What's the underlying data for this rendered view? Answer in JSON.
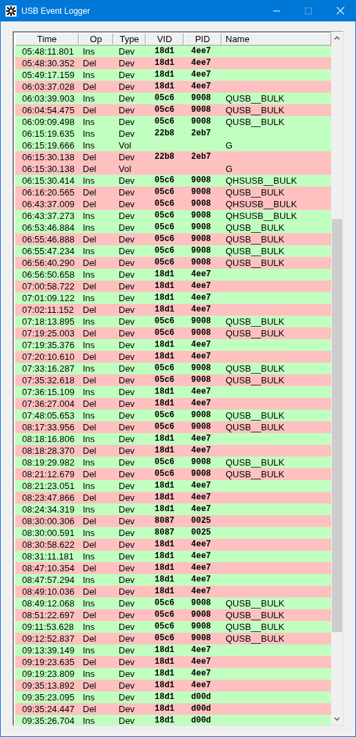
{
  "window": {
    "title": "USB Event Logger"
  },
  "table": {
    "columns": [
      "Time",
      "Op",
      "Type",
      "VID",
      "PID",
      "Name"
    ],
    "rows": [
      {
        "kind": "ins",
        "time": "05:48:11.801",
        "op": "Ins",
        "type": "Dev",
        "vid": "18d1",
        "pid": "4ee7"
      },
      {
        "kind": "del",
        "time": "05:48:30.352",
        "op": "Del",
        "type": "Dev",
        "vid": "18d1",
        "pid": "4ee7"
      },
      {
        "kind": "ins",
        "time": "05:49:17.159",
        "op": "Ins",
        "type": "Dev",
        "vid": "18d1",
        "pid": "4ee7"
      },
      {
        "kind": "del",
        "time": "06:03:37.028",
        "op": "Del",
        "type": "Dev",
        "vid": "18d1",
        "pid": "4ee7"
      },
      {
        "kind": "ins",
        "time": "06:03:39.903",
        "op": "Ins",
        "type": "Dev",
        "vid": "05c6",
        "pid": "9008",
        "name": "QUSB__BULK"
      },
      {
        "kind": "del",
        "time": "06:04:54.475",
        "op": "Del",
        "type": "Dev",
        "vid": "05c6",
        "pid": "9008",
        "name": "QUSB__BULK"
      },
      {
        "kind": "ins",
        "time": "06:09:09.498",
        "op": "Ins",
        "type": "Dev",
        "vid": "05c6",
        "pid": "9008",
        "name": "QUSB__BULK"
      },
      {
        "kind": "ins",
        "time": "06:15:19.635",
        "op": "Ins",
        "type": "Dev",
        "vid": "22b8",
        "pid": "2eb7"
      },
      {
        "kind": "ins",
        "time": "06:15:19.666",
        "op": "Ins",
        "type": "Vol",
        "name": "G"
      },
      {
        "kind": "del",
        "time": "06:15:30.138",
        "op": "Del",
        "type": "Dev",
        "vid": "22b8",
        "pid": "2eb7"
      },
      {
        "kind": "del",
        "time": "06:15:30.138",
        "op": "Del",
        "type": "Vol",
        "name": "G"
      },
      {
        "kind": "ins",
        "time": "06:15:30.414",
        "op": "Ins",
        "type": "Dev",
        "vid": "05c6",
        "pid": "9008",
        "name": "QHSUSB__BULK"
      },
      {
        "kind": "del",
        "time": "06:16:20.565",
        "op": "Del",
        "type": "Dev",
        "vid": "05c6",
        "pid": "9008",
        "name": "QUSB__BULK"
      },
      {
        "kind": "del",
        "time": "06:43:37.009",
        "op": "Del",
        "type": "Dev",
        "vid": "05c6",
        "pid": "9008",
        "name": "QHSUSB__BULK"
      },
      {
        "kind": "ins",
        "time": "06:43:37.273",
        "op": "Ins",
        "type": "Dev",
        "vid": "05c6",
        "pid": "9008",
        "name": "QHSUSB__BULK"
      },
      {
        "kind": "ins",
        "time": "06:53:46.884",
        "op": "Ins",
        "type": "Dev",
        "vid": "05c6",
        "pid": "9008",
        "name": "QUSB__BULK"
      },
      {
        "kind": "del",
        "time": "06:55:46.888",
        "op": "Del",
        "type": "Dev",
        "vid": "05c6",
        "pid": "9008",
        "name": "QUSB__BULK"
      },
      {
        "kind": "ins",
        "time": "06:55:47.234",
        "op": "Ins",
        "type": "Dev",
        "vid": "05c6",
        "pid": "9008",
        "name": "QUSB__BULK"
      },
      {
        "kind": "del",
        "time": "06:56:40.290",
        "op": "Del",
        "type": "Dev",
        "vid": "05c6",
        "pid": "9008",
        "name": "QUSB__BULK"
      },
      {
        "kind": "ins",
        "time": "06:56:50.658",
        "op": "Ins",
        "type": "Dev",
        "vid": "18d1",
        "pid": "4ee7"
      },
      {
        "kind": "del",
        "time": "07:00:58.722",
        "op": "Del",
        "type": "Dev",
        "vid": "18d1",
        "pid": "4ee7"
      },
      {
        "kind": "ins",
        "time": "07:01:09.122",
        "op": "Ins",
        "type": "Dev",
        "vid": "18d1",
        "pid": "4ee7"
      },
      {
        "kind": "del",
        "time": "07:02:11.152",
        "op": "Del",
        "type": "Dev",
        "vid": "18d1",
        "pid": "4ee7"
      },
      {
        "kind": "ins",
        "time": "07:18:13.895",
        "op": "Ins",
        "type": "Dev",
        "vid": "05c6",
        "pid": "9008",
        "name": "QUSB__BULK"
      },
      {
        "kind": "del",
        "time": "07:19:25.003",
        "op": "Del",
        "type": "Dev",
        "vid": "05c6",
        "pid": "9008",
        "name": "QUSB__BULK"
      },
      {
        "kind": "ins",
        "time": "07:19:35.376",
        "op": "Ins",
        "type": "Dev",
        "vid": "18d1",
        "pid": "4ee7"
      },
      {
        "kind": "del",
        "time": "07:20:10.610",
        "op": "Del",
        "type": "Dev",
        "vid": "18d1",
        "pid": "4ee7"
      },
      {
        "kind": "ins",
        "time": "07:33:16.287",
        "op": "Ins",
        "type": "Dev",
        "vid": "05c6",
        "pid": "9008",
        "name": "QUSB__BULK"
      },
      {
        "kind": "del",
        "time": "07:35:32.618",
        "op": "Del",
        "type": "Dev",
        "vid": "05c6",
        "pid": "9008",
        "name": "QUSB__BULK"
      },
      {
        "kind": "ins",
        "time": "07:36:15.109",
        "op": "Ins",
        "type": "Dev",
        "vid": "18d1",
        "pid": "4ee7"
      },
      {
        "kind": "del",
        "time": "07:36:27.004",
        "op": "Del",
        "type": "Dev",
        "vid": "18d1",
        "pid": "4ee7"
      },
      {
        "kind": "ins",
        "time": "07:48:05.653",
        "op": "Ins",
        "type": "Dev",
        "vid": "05c6",
        "pid": "9008",
        "name": "QUSB__BULK"
      },
      {
        "kind": "del",
        "time": "08:17:33.956",
        "op": "Del",
        "type": "Dev",
        "vid": "05c6",
        "pid": "9008",
        "name": "QUSB__BULK"
      },
      {
        "kind": "ins",
        "time": "08:18:16.806",
        "op": "Ins",
        "type": "Dev",
        "vid": "18d1",
        "pid": "4ee7"
      },
      {
        "kind": "del",
        "time": "08:18:28.370",
        "op": "Del",
        "type": "Dev",
        "vid": "18d1",
        "pid": "4ee7"
      },
      {
        "kind": "ins",
        "time": "08:19:29.982",
        "op": "Ins",
        "type": "Dev",
        "vid": "05c6",
        "pid": "9008",
        "name": "QUSB__BULK"
      },
      {
        "kind": "del",
        "time": "08:21:12.679",
        "op": "Del",
        "type": "Dev",
        "vid": "05c6",
        "pid": "9008",
        "name": "QUSB__BULK"
      },
      {
        "kind": "ins",
        "time": "08:21:23.051",
        "op": "Ins",
        "type": "Dev",
        "vid": "18d1",
        "pid": "4ee7"
      },
      {
        "kind": "del",
        "time": "08:23:47.866",
        "op": "Del",
        "type": "Dev",
        "vid": "18d1",
        "pid": "4ee7"
      },
      {
        "kind": "ins",
        "time": "08:24:34.319",
        "op": "Ins",
        "type": "Dev",
        "vid": "18d1",
        "pid": "4ee7"
      },
      {
        "kind": "del",
        "time": "08:30:00.306",
        "op": "Del",
        "type": "Dev",
        "vid": "8087",
        "pid": "0025"
      },
      {
        "kind": "ins",
        "time": "08:30:00.591",
        "op": "Ins",
        "type": "Dev",
        "vid": "8087",
        "pid": "0025"
      },
      {
        "kind": "del",
        "time": "08:30:58.622",
        "op": "Del",
        "type": "Dev",
        "vid": "18d1",
        "pid": "4ee7"
      },
      {
        "kind": "ins",
        "time": "08:31:11.181",
        "op": "Ins",
        "type": "Dev",
        "vid": "18d1",
        "pid": "4ee7"
      },
      {
        "kind": "del",
        "time": "08:47:10.354",
        "op": "Del",
        "type": "Dev",
        "vid": "18d1",
        "pid": "4ee7"
      },
      {
        "kind": "ins",
        "time": "08:47:57.294",
        "op": "Ins",
        "type": "Dev",
        "vid": "18d1",
        "pid": "4ee7"
      },
      {
        "kind": "del",
        "time": "08:49:10.036",
        "op": "Del",
        "type": "Dev",
        "vid": "18d1",
        "pid": "4ee7"
      },
      {
        "kind": "ins",
        "time": "08:49:12.068",
        "op": "Ins",
        "type": "Dev",
        "vid": "05c6",
        "pid": "9008",
        "name": "QUSB__BULK"
      },
      {
        "kind": "del",
        "time": "08:51:22.697",
        "op": "Del",
        "type": "Dev",
        "vid": "05c6",
        "pid": "9008",
        "name": "QUSB__BULK"
      },
      {
        "kind": "ins",
        "time": "09:11:53.628",
        "op": "Ins",
        "type": "Dev",
        "vid": "05c6",
        "pid": "9008",
        "name": "QUSB__BULK"
      },
      {
        "kind": "del",
        "time": "09:12:52.837",
        "op": "Del",
        "type": "Dev",
        "vid": "05c6",
        "pid": "9008",
        "name": "QUSB__BULK"
      },
      {
        "kind": "ins",
        "time": "09:13:39.149",
        "op": "Ins",
        "type": "Dev",
        "vid": "18d1",
        "pid": "4ee7"
      },
      {
        "kind": "del",
        "time": "09:19:23.635",
        "op": "Del",
        "type": "Dev",
        "vid": "18d1",
        "pid": "4ee7"
      },
      {
        "kind": "ins",
        "time": "09:19:23.809",
        "op": "Ins",
        "type": "Dev",
        "vid": "18d1",
        "pid": "4ee7"
      },
      {
        "kind": "del",
        "time": "09:35:13.892",
        "op": "Del",
        "type": "Dev",
        "vid": "18d1",
        "pid": "4ee7"
      },
      {
        "kind": "ins",
        "time": "09:35:23.095",
        "op": "Ins",
        "type": "Dev",
        "vid": "18d1",
        "pid": "d00d"
      },
      {
        "kind": "del",
        "time": "09:35:24.447",
        "op": "Del",
        "type": "Dev",
        "vid": "18d1",
        "pid": "d00d"
      },
      {
        "kind": "ins",
        "time": "09:35:26.704",
        "op": "Ins",
        "type": "Dev",
        "vid": "18d1",
        "pid": "d00d"
      }
    ]
  }
}
